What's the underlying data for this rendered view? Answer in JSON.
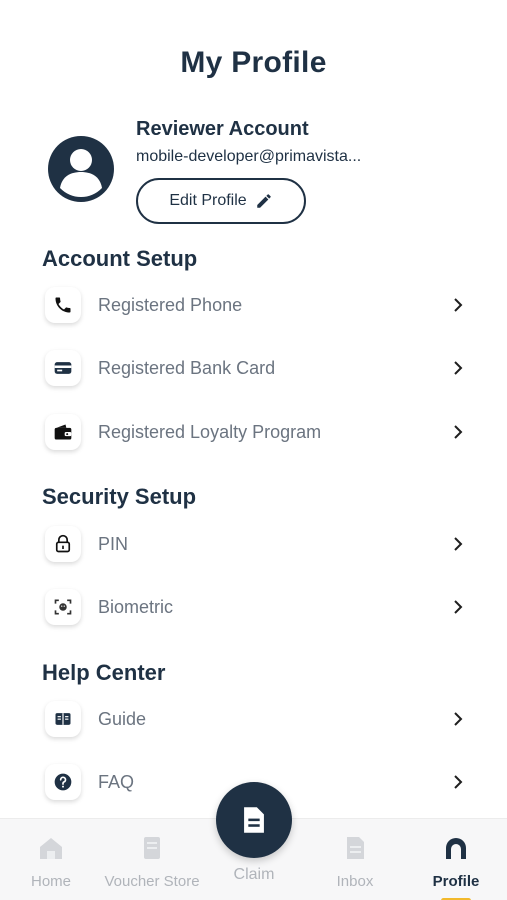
{
  "header": {
    "title": "My Profile"
  },
  "profile": {
    "name": "Reviewer Account",
    "email": "mobile-developer@primavista...",
    "edit_label": "Edit Profile"
  },
  "account_setup": {
    "title": "Account Setup",
    "items": [
      {
        "label": "Registered Phone",
        "icon": "phone-icon"
      },
      {
        "label": "Registered Bank Card",
        "icon": "card-icon"
      },
      {
        "label": "Registered Loyalty Program",
        "icon": "wallet-icon"
      }
    ]
  },
  "security_setup": {
    "title": "Security Setup",
    "items": [
      {
        "label": "PIN",
        "icon": "lock-icon"
      },
      {
        "label": "Biometric",
        "icon": "face-scan-icon"
      }
    ]
  },
  "help_center": {
    "title": "Help Center",
    "items": [
      {
        "label": "Guide",
        "icon": "book-icon"
      },
      {
        "label": "FAQ",
        "icon": "question-icon"
      }
    ]
  },
  "tabbar": {
    "home": "Home",
    "voucher_store": "Voucher Store",
    "claim": "Claim",
    "inbox": "Inbox",
    "profile": "Profile",
    "active": "profile"
  },
  "colors": {
    "primary": "#1f3144",
    "muted_text": "#6b7480",
    "inactive_tab": "#b0b4ba",
    "accent": "#f2b92b"
  }
}
